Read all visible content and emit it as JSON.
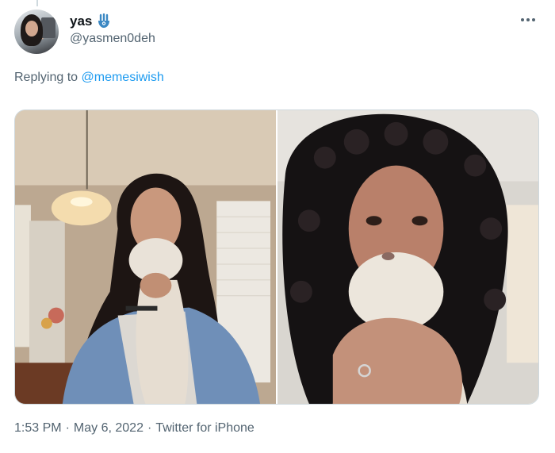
{
  "tweet": {
    "display_name": "yas",
    "handle": "@yasmen0deh",
    "replying_prefix": "Replying to",
    "replying_to": "@memesiwish",
    "time": "1:53 PM",
    "separator": "·",
    "date": "May 6, 2022",
    "source": "Twitter for iPhone"
  },
  "icons": {
    "more": "more-options-icon",
    "emoji": "hamsa-icon"
  },
  "colors": {
    "link": "#1d9bf0",
    "secondary_text": "#536471",
    "emoji_blue": "#3b88c3"
  }
}
